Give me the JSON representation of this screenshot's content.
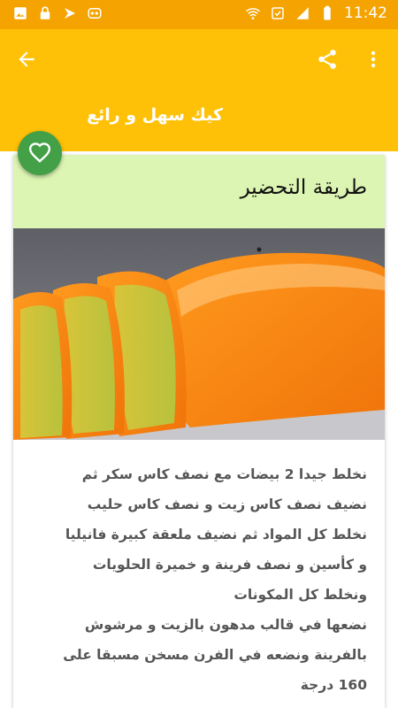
{
  "status_bar": {
    "time": "11:42",
    "left_icons": [
      "gallery-icon",
      "lock-icon",
      "flag-icon",
      "game-icon"
    ],
    "right_icons": [
      "wifi-icon",
      "sync-icon",
      "signal-icon",
      "battery-icon"
    ]
  },
  "app_bar": {
    "title": "كيك سهل و رائع",
    "back_icon": "arrow-back-icon",
    "share_icon": "share-icon",
    "more_icon": "more-vert-icon"
  },
  "fab": {
    "icon": "heart-icon"
  },
  "card": {
    "heading": "طريقة التحضير",
    "image": "orange-cake-slices",
    "lines": [
      "نخلط جيدا 2 بيضات مع نصف كاس سكر ثم",
      "نضيف نصف كاس زيت و نصف كاس حليب",
      "نخلط كل المواد ثم نضيف ملعقة كبيرة فانيليا",
      "و كأسين و نصف فرينة و خميرة الحلويات",
      "ونخلط كل المكونات",
      "نضعها في قالب مدهون بالزيت و مرشوش",
      "بالفرينة ونضعه في الفرن مسخن مسبقا على",
      "160 درجة"
    ]
  },
  "colors": {
    "status_bar": "#f5a300",
    "app_bar": "#ffc107",
    "card_header": "#dcf5b3",
    "fab": "#43a047",
    "body_text": "#555555"
  }
}
